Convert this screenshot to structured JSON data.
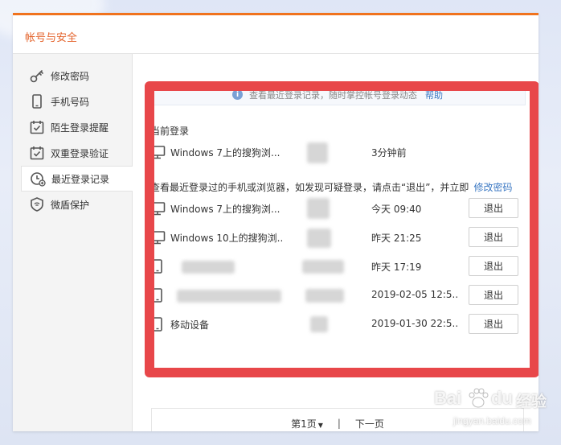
{
  "dialog": {
    "title": "帐号与安全"
  },
  "sidebar": {
    "items": [
      {
        "label": "修改密码",
        "icon": "key-icon"
      },
      {
        "label": "手机号码",
        "icon": "phone-icon"
      },
      {
        "label": "陌生登录提醒",
        "icon": "calendar-check-icon"
      },
      {
        "label": "双重登录验证",
        "icon": "calendar-check-icon"
      },
      {
        "label": "最近登录记录",
        "icon": "clock-plus-icon",
        "active": true
      },
      {
        "label": "微盾保护",
        "icon": "shield-icon"
      }
    ]
  },
  "info": {
    "text": "查看最近登录记录，随时掌控帐号登录动态",
    "link": "帮助"
  },
  "current": {
    "heading": "当前登录",
    "device": "Windows 7上的搜狗浏...",
    "time": "3分钟前"
  },
  "recent": {
    "heading": "查看最近登录过的手机或浏览器，如发现可疑登录，请点击“退出”，并立即",
    "link": "修改密码",
    "logout_label": "退出",
    "rows": [
      {
        "device": "Windows 7上的搜狗浏...",
        "time": "今天 09:40",
        "icon": "monitor-icon"
      },
      {
        "device": "Windows 10上的搜狗浏..",
        "time": "昨天 21:25",
        "icon": "monitor-icon"
      },
      {
        "device": "",
        "time": "昨天 17:19",
        "icon": "mobile-icon"
      },
      {
        "device": "",
        "time": "2019-02-05 12:5..",
        "icon": "mobile-icon"
      },
      {
        "device": "移动设备",
        "time": "2019-01-30 22:5..",
        "icon": "mobile-icon"
      }
    ]
  },
  "pager": {
    "page": "第1页",
    "separator": "|",
    "next": "下一页"
  },
  "watermark": {
    "brand": "Bai",
    "brand2": "du",
    "suffix": "经验",
    "url": "jingyan.baidu.com"
  },
  "colors": {
    "accent": "#f0731e",
    "link": "#3b78c3",
    "highlight_frame": "#e8474a"
  }
}
